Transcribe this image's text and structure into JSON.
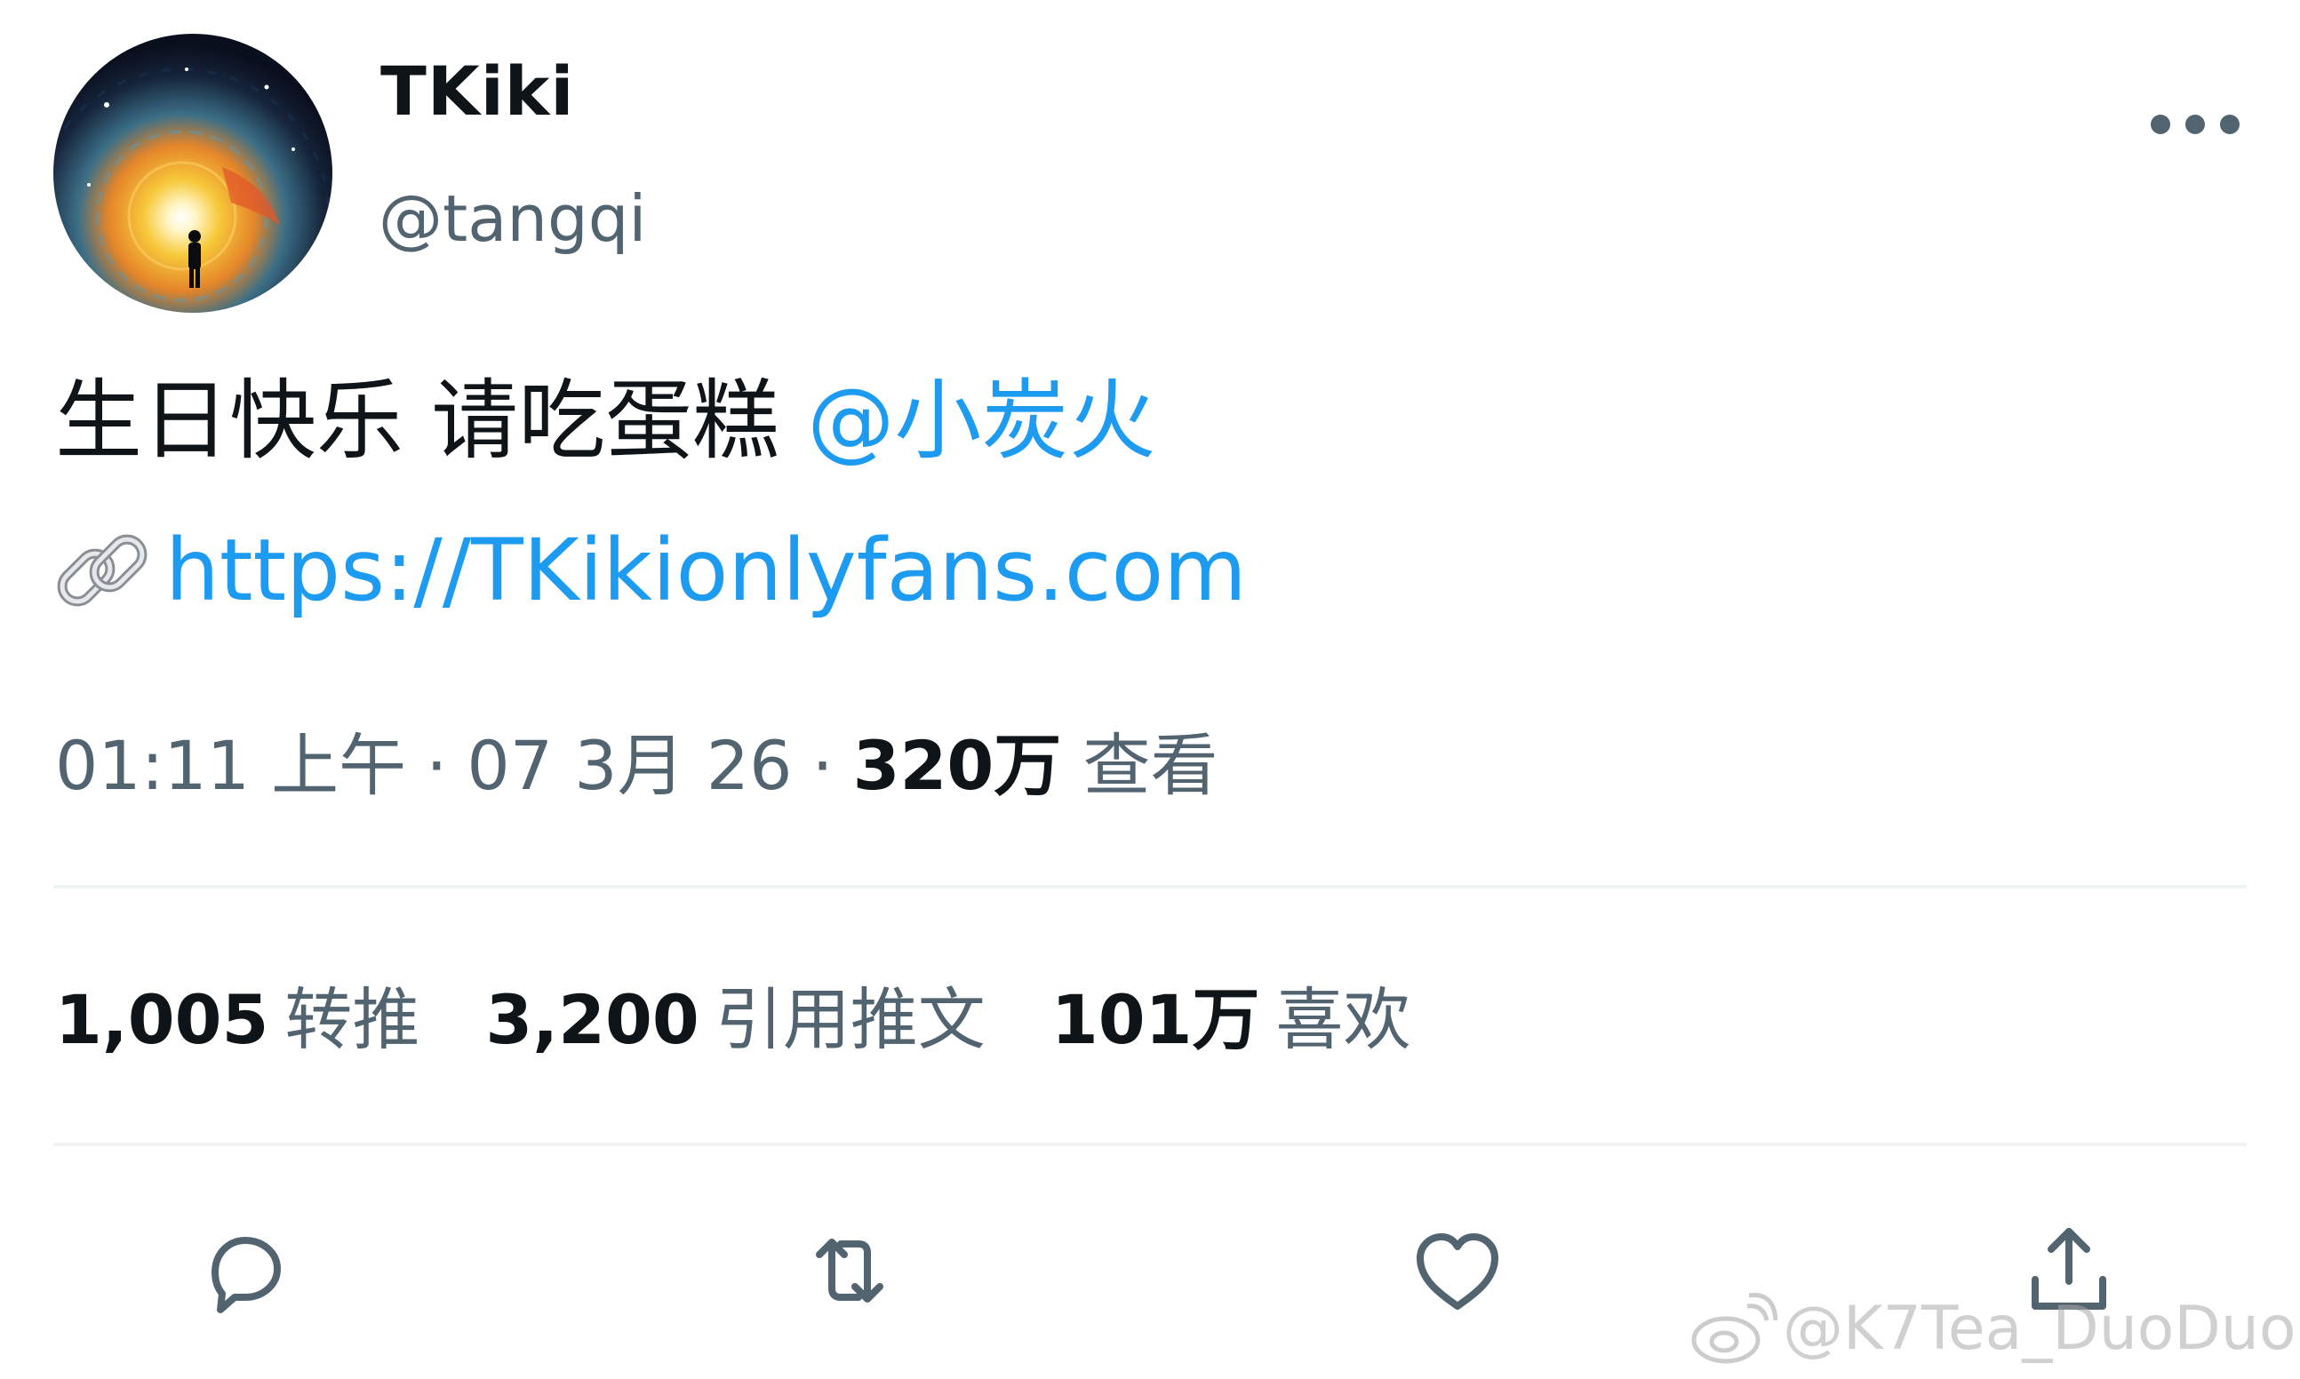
{
  "user": {
    "display_name": "TKiki",
    "handle": "@tangqi",
    "avatar_icon": "galaxy-vortex-avatar"
  },
  "tweet": {
    "text": "生日快乐 请吃蛋糕 ",
    "mention": "@小炭火",
    "link_icon": "link-icon",
    "link": "https://TKikionlyfans.com"
  },
  "meta": {
    "time": "01:11 上午",
    "sep1": "·",
    "date": "07 3月 26",
    "sep2": "·",
    "views_count": "320万",
    "views_label": "查看"
  },
  "stats": {
    "retweets": {
      "count": "1,005",
      "label": "转推"
    },
    "quotes": {
      "count": "3,200",
      "label": "引用推文"
    },
    "likes": {
      "count": "101万",
      "label": "喜欢"
    }
  },
  "actions": [
    "reply-icon",
    "retweet-icon",
    "like-icon",
    "share-icon"
  ],
  "watermark": {
    "text": "@K7Tea_DuoDuo"
  },
  "colors": {
    "link_blue": "#1d9bf0",
    "secondary_text": "#536471",
    "primary_text": "#0f1419",
    "divider": "#eff3f4"
  }
}
